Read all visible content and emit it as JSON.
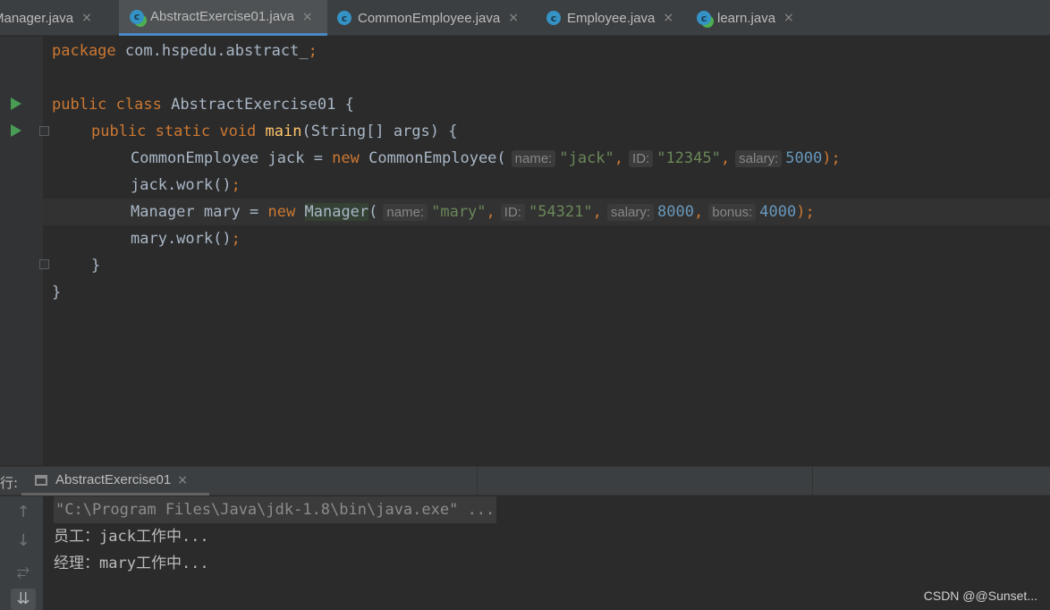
{
  "tabs": [
    {
      "label": "Manager.java",
      "active": false
    },
    {
      "label": "AbstractExercise01.java",
      "active": true
    },
    {
      "label": "CommonEmployee.java",
      "active": false
    },
    {
      "label": "Employee.java",
      "active": false
    },
    {
      "label": "learn.java",
      "active": false
    }
  ],
  "tab_close_glyph": "×",
  "class_icon_letter": "c",
  "code": {
    "l1": {
      "kw": "package",
      "rest": " com.hspedu.abstract_",
      "semi": ";"
    },
    "l3": {
      "kw1": "public",
      "kw2": "class",
      "name": "AbstractExercise01",
      "brace": " {"
    },
    "l4": {
      "kw1": "public",
      "kw2": "static",
      "kw3": "void",
      "fn": "main",
      "rest": "(String[] args) {"
    },
    "l5": {
      "a": "CommonEmployee jack = ",
      "new": "new",
      "b": " CommonEmployee(",
      "h1": "name:",
      "s1": "\"jack\"",
      "c1": ",",
      "h2": "ID:",
      "s2": "\"12345\"",
      "c2": ",",
      "h3": "salary:",
      "n1": "5000",
      "end": ");"
    },
    "l6": {
      "a": "jack.work()",
      "semi": ";"
    },
    "l7": {
      "a": "Manager mary = ",
      "new": "new",
      "sp": " ",
      "cls": "Manager",
      "paren": "(",
      "h1": "name:",
      "s1": "\"mary\"",
      "c1": ",",
      "h2": "ID:",
      "s2": "\"54321\"",
      "c2": ",",
      "h3": "salary:",
      "n1": "8000",
      "c3": ",",
      "h4": "bonus:",
      "n2": "4000",
      "end": ");"
    },
    "l8": {
      "a": "mary.work()",
      "semi": ";"
    },
    "l9": "}",
    "l10": "}"
  },
  "run_panel": {
    "prefix": "行:",
    "tab_label": "AbstractExercise01",
    "console": [
      "\"C:\\Program Files\\Java\\jdk-1.8\\bin\\java.exe\" ...",
      "员工：jack工作中...",
      "经理：mary工作中..."
    ]
  },
  "side_icons": {
    "up": "↑",
    "down": "↓",
    "wrap": "⥂",
    "scroll": "⇊"
  },
  "watermark": "CSDN @@Sunset...",
  "colors": {
    "keyword": "#cc7832",
    "string": "#6a8759",
    "number": "#6897bb",
    "function": "#ffc66d",
    "accent": "#4a88c7"
  }
}
